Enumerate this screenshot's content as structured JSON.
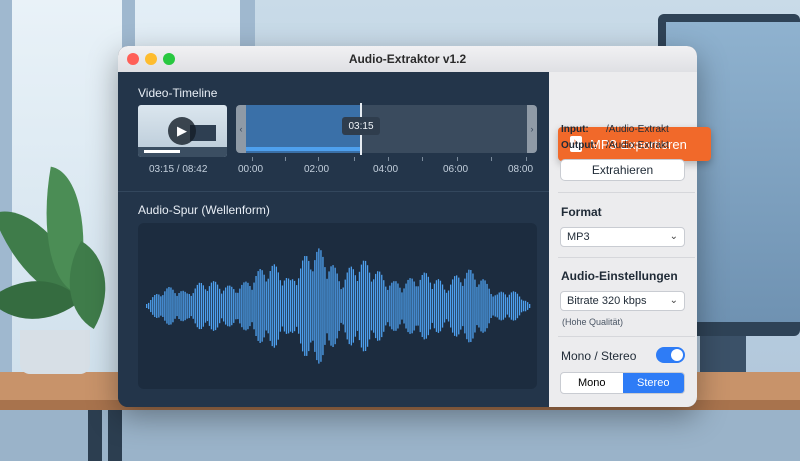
{
  "window": {
    "title": "Audio-Extraktor v1.2"
  },
  "timeline": {
    "title": "Video-Timeline",
    "current_time": "03:15",
    "time_display": "03:15 / 08:42",
    "ticks": [
      "00:00",
      "02:00",
      "04:00",
      "06:00",
      "08:00"
    ],
    "selection_start_fraction": 0.0,
    "playhead_fraction": 0.374
  },
  "audio_track": {
    "title": "Audio-Spur (Wellenform)"
  },
  "export": {
    "button_label": "MP3 Exportieren",
    "input_label": "Input:",
    "input_value": "/Audio-Extrakt",
    "output_label": "Output:",
    "output_value": "/Audio-Extrakt",
    "extract_label": "Extrahieren"
  },
  "format": {
    "label": "Format",
    "selected": "MP3"
  },
  "audio_settings": {
    "label": "Audio-Einstellungen",
    "bitrate_selected": "Bitrate 320 kbps",
    "quality_note": "(Hohe Qualität)"
  },
  "channels": {
    "label": "Mono / Stereo",
    "toggle_on": true,
    "options": [
      "Mono",
      "Stereo"
    ],
    "selected": "Stereo"
  },
  "colors": {
    "accent": "#2e7cf6",
    "export": "#f1692a",
    "wave": "#4ea0ee"
  }
}
